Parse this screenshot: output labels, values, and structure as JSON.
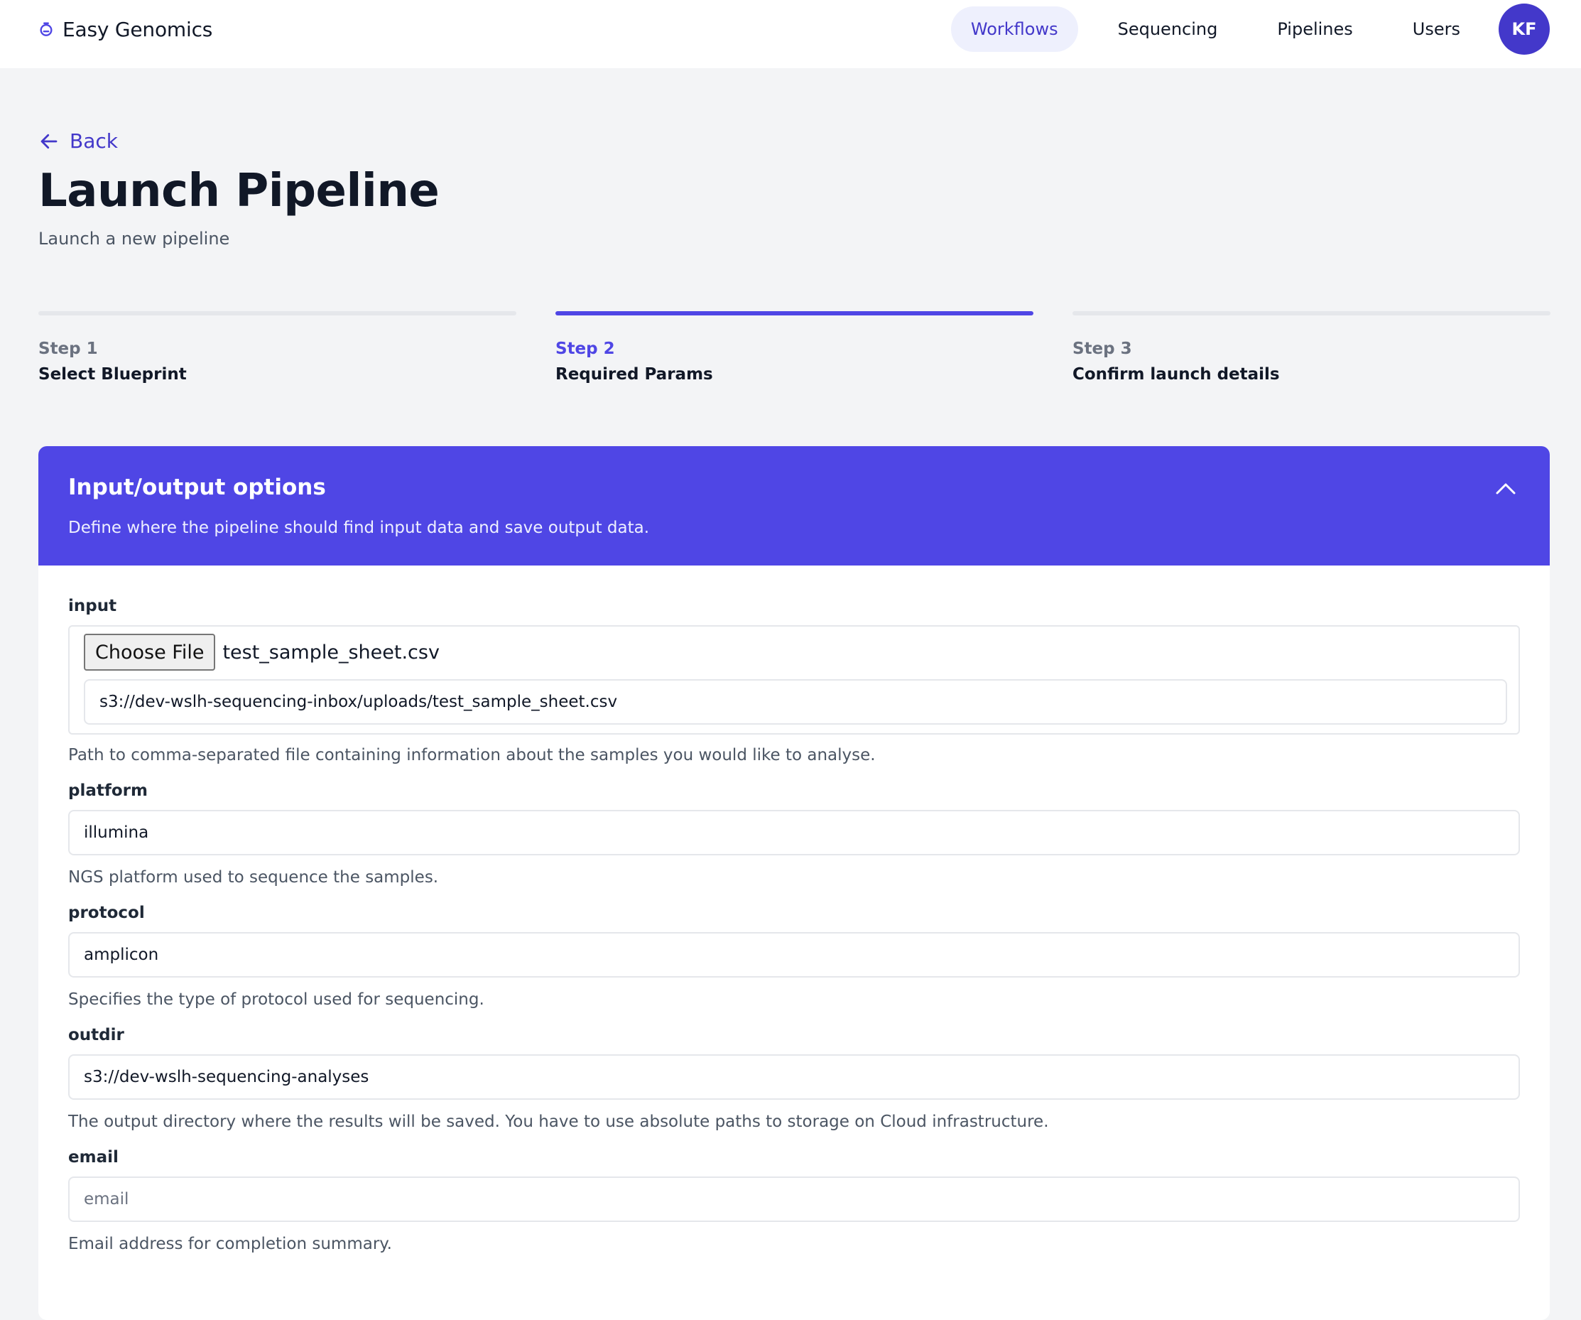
{
  "brand": {
    "name": "Easy Genomics",
    "icon": "stopwatch-logo-icon"
  },
  "nav": {
    "items": [
      {
        "label": "Workflows",
        "active": true
      },
      {
        "label": "Sequencing",
        "active": false
      },
      {
        "label": "Pipelines",
        "active": false
      },
      {
        "label": "Users",
        "active": false
      }
    ],
    "avatar_initials": "KF"
  },
  "header": {
    "back_label": "Back",
    "title": "Launch Pipeline",
    "subtitle": "Launch a new pipeline"
  },
  "steps": [
    {
      "number": "Step 1",
      "name": "Select Blueprint",
      "current": false
    },
    {
      "number": "Step 2",
      "name": "Required Params",
      "current": true
    },
    {
      "number": "Step 3",
      "name": "Confirm launch details",
      "current": false
    }
  ],
  "section": {
    "title": "Input/output options",
    "description": "Define where the pipeline should find input data and save output data.",
    "expanded": true
  },
  "fields": {
    "input": {
      "label": "input",
      "choose_file_label": "Choose File",
      "file_name": "test_sample_sheet.csv",
      "value": "s3://dev-wslh-sequencing-inbox/uploads/test_sample_sheet.csv",
      "help": "Path to comma-separated file containing information about the samples you would like to analyse."
    },
    "platform": {
      "label": "platform",
      "value": "illumina",
      "help": "NGS platform used to sequence the samples."
    },
    "protocol": {
      "label": "protocol",
      "value": "amplicon",
      "help": "Specifies the type of protocol used for sequencing."
    },
    "outdir": {
      "label": "outdir",
      "value": "s3://dev-wslh-sequencing-analyses",
      "help": "The output directory where the results will be saved. You have to use absolute paths to storage on Cloud infrastructure."
    },
    "email": {
      "label": "email",
      "value": "",
      "placeholder": "email",
      "help": "Email address for completion summary."
    }
  },
  "colors": {
    "accent": "#4f46e5",
    "accent_dark": "#4338ca",
    "nav_active_bg": "#eef0fd",
    "page_bg": "#f3f4f6"
  }
}
